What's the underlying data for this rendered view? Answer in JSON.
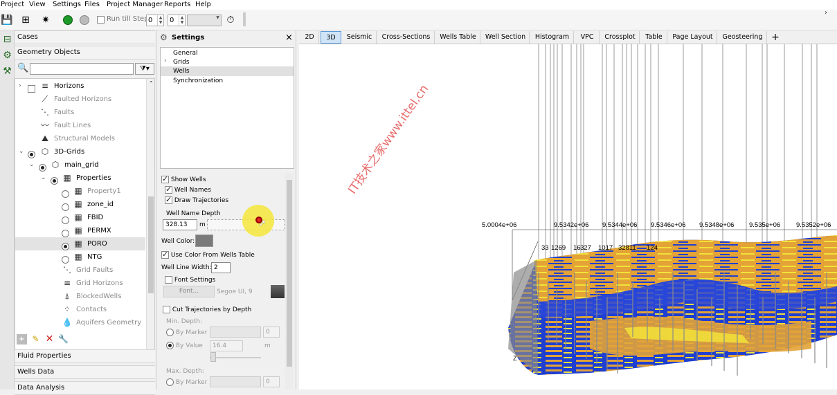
{
  "menubar": [
    "Project",
    "View",
    "Settings",
    "Files",
    "Project Manager",
    "Reports",
    "Help"
  ],
  "toolbar": {
    "run_till_step_label": "Run till Step:",
    "step_value_1": "0",
    "step_value_2": "0"
  },
  "left": {
    "cases_label": "Cases",
    "geometry_label": "Geometry Objects",
    "search_placeholder": "",
    "tree": [
      {
        "label": "Horizons",
        "gray": false
      },
      {
        "label": "Faulted Horizons",
        "gray": true
      },
      {
        "label": "Faults",
        "gray": true
      },
      {
        "label": "Fault Lines",
        "gray": true
      },
      {
        "label": "Structural Models",
        "gray": true
      },
      {
        "label": "3D-Grids",
        "gray": false
      },
      {
        "label": "main_grid",
        "gray": false
      },
      {
        "label": "Properties",
        "gray": false
      },
      {
        "label": "Property1",
        "gray": true
      },
      {
        "label": "zone_id",
        "gray": false
      },
      {
        "label": "FBID",
        "gray": false
      },
      {
        "label": "PERMX",
        "gray": false
      },
      {
        "label": "PORO",
        "gray": false
      },
      {
        "label": "NTG",
        "gray": false
      },
      {
        "label": "Grid Faults",
        "gray": true
      },
      {
        "label": "Grid Horizons",
        "gray": true
      },
      {
        "label": "BlockedWells",
        "gray": true
      },
      {
        "label": "Contacts",
        "gray": true
      },
      {
        "label": "Aquifers Geometry",
        "gray": true
      }
    ],
    "fluid_properties_label": "Fluid Properties",
    "wells_data_label": "Wells Data",
    "data_analysis_label": "Data Analysis"
  },
  "settings": {
    "title": "Settings",
    "close": "×",
    "tree": [
      "General",
      "Grids",
      "Wells",
      "Synchronization"
    ],
    "show_wells": "Show Wells",
    "well_names": "Well Names",
    "draw_trajectories": "Draw Trajectories",
    "well_name_depth": "Well Name Depth",
    "depth_value": "328.13",
    "depth_unit": "m",
    "well_color": "Well Color:",
    "use_color_from_table": "Use Color From Wells Table",
    "well_line_width": "Well Line Width:",
    "line_width_value": "2",
    "font_settings": "Font Settings",
    "font_button": "Font...",
    "font_name": "Segoe UI, 9",
    "cut_trajectories": "Cut Trajectories by Depth",
    "min_depth": "Min. Depth:",
    "by_marker": "By Marker",
    "by_value": "By Value",
    "marker_value": "0",
    "value_field": "16.4",
    "unit_m": "m",
    "max_depth": "Max. Depth:",
    "by_marker_2": "By Marker",
    "marker_value_2": "0"
  },
  "tabs": [
    "2D",
    "3D",
    "Seismic",
    "Cross-Sections",
    "Wells Table",
    "Well Section",
    "Histogram",
    "VPC",
    "Crossplot",
    "Table",
    "Page Layout",
    "Geosteering",
    "+"
  ],
  "view": {
    "axis_labels": [
      "5.0004e+06",
      "9.5342e+06",
      "9.5344e+06",
      "9.5346e+06",
      "9.5348e+06",
      "9.535e+06",
      "9.5352e+06"
    ],
    "well_labels": [
      "33",
      "1269",
      "16",
      "327",
      "1017",
      "32811",
      "124"
    ],
    "z_label": "Z",
    "watermark": "IT技术之家www.ittel.cn"
  },
  "colors": {
    "accent": "#5b9bd5",
    "blue": "#1f3fd1",
    "orange": "#e3a336",
    "yellow": "#f2e23a",
    "cursor_highlight": "#f5e63b"
  }
}
